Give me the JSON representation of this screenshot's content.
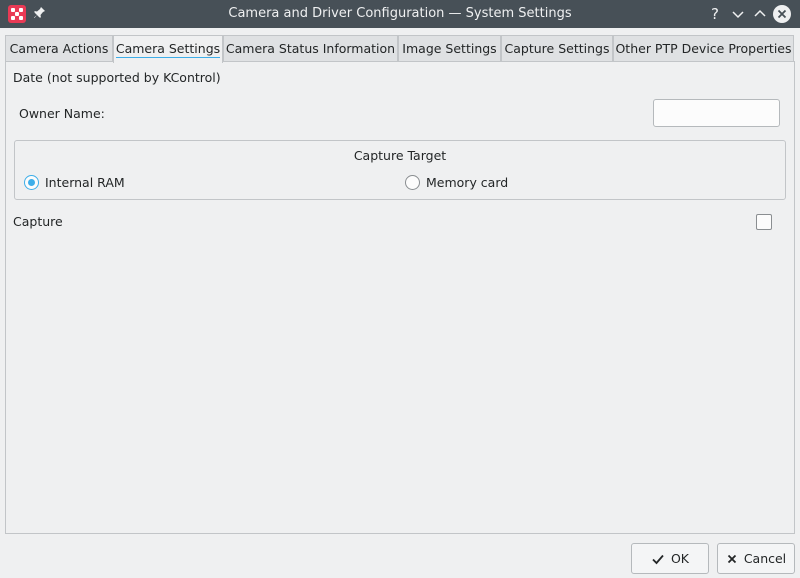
{
  "window": {
    "title": "Camera and Driver Configuration — System Settings",
    "help_label": "?"
  },
  "tabs": [
    {
      "label": "Camera Actions",
      "active": false
    },
    {
      "label": "Camera Settings",
      "active": true
    },
    {
      "label": "Camera Status Information",
      "active": false
    },
    {
      "label": "Image Settings",
      "active": false
    },
    {
      "label": "Capture Settings",
      "active": false
    },
    {
      "label": "Other PTP Device Properties",
      "active": false
    }
  ],
  "settings": {
    "date_label": "Date (not supported by KControl)",
    "owner_label": "Owner Name:",
    "owner_value": "",
    "capture_target": {
      "title": "Capture Target",
      "options": [
        {
          "label": "Internal RAM",
          "selected": true
        },
        {
          "label": "Memory card",
          "selected": false
        }
      ]
    },
    "capture_label": "Capture",
    "capture_checked": false
  },
  "buttons": {
    "ok": "OK",
    "cancel": "Cancel"
  },
  "colors": {
    "titlebar": "#475057",
    "accent": "#3daee9",
    "background": "#eff0f1",
    "app_icon": "#e93a55"
  }
}
